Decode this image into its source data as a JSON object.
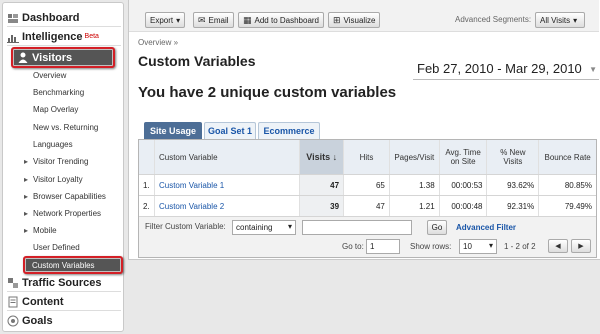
{
  "sidebar": {
    "dashboard": "Dashboard",
    "intelligence": "Intelligence",
    "intelligence_badge": "Beta",
    "visitors": "Visitors",
    "items": [
      {
        "label": "Overview",
        "arrow": false
      },
      {
        "label": "Benchmarking",
        "arrow": false
      },
      {
        "label": "Map Overlay",
        "arrow": false
      },
      {
        "label": "New vs. Returning",
        "arrow": false
      },
      {
        "label": "Languages",
        "arrow": false
      },
      {
        "label": "Visitor Trending",
        "arrow": true
      },
      {
        "label": "Visitor Loyalty",
        "arrow": true
      },
      {
        "label": "Browser Capabilities",
        "arrow": true
      },
      {
        "label": "Network Properties",
        "arrow": true
      },
      {
        "label": "Mobile",
        "arrow": true
      },
      {
        "label": "User Defined",
        "arrow": false
      }
    ],
    "custom_variables": "Custom Variables",
    "traffic_sources": "Traffic Sources",
    "content": "Content",
    "goals": "Goals"
  },
  "toolbar": {
    "export": "Export",
    "email": "Email",
    "add_dashboard": "Add to Dashboard",
    "visualize": "Visualize",
    "segments_label": "Advanced Segments:",
    "segments_value": "All Visits"
  },
  "breadcrumb": "Overview »",
  "page_title": "Custom Variables",
  "date_range": "Feb 27, 2010 - Mar 29, 2010",
  "headline": "You have 2 unique custom variables",
  "tabs": [
    "Site Usage",
    "Goal Set 1",
    "Ecommerce"
  ],
  "table": {
    "headers": [
      "",
      "Custom Variable",
      "Visits ↓",
      "Hits",
      "Pages/Visit",
      "Avg. Time on Site",
      "% New Visits",
      "Bounce Rate"
    ],
    "rows": [
      [
        "1.",
        "Custom Variable 1",
        "47",
        "65",
        "1.38",
        "00:00:53",
        "93.62%",
        "80.85%"
      ],
      [
        "2.",
        "Custom Variable 2",
        "39",
        "47",
        "1.21",
        "00:00:48",
        "92.31%",
        "79.49%"
      ]
    ]
  },
  "filter": {
    "label": "Filter Custom Variable:",
    "mode": "containing",
    "go": "Go",
    "advanced": "Advanced Filter",
    "goto_label": "Go to:",
    "goto_value": "1",
    "rows_label": "Show rows:",
    "rows_value": "10",
    "range": "1 - 2 of 2"
  }
}
